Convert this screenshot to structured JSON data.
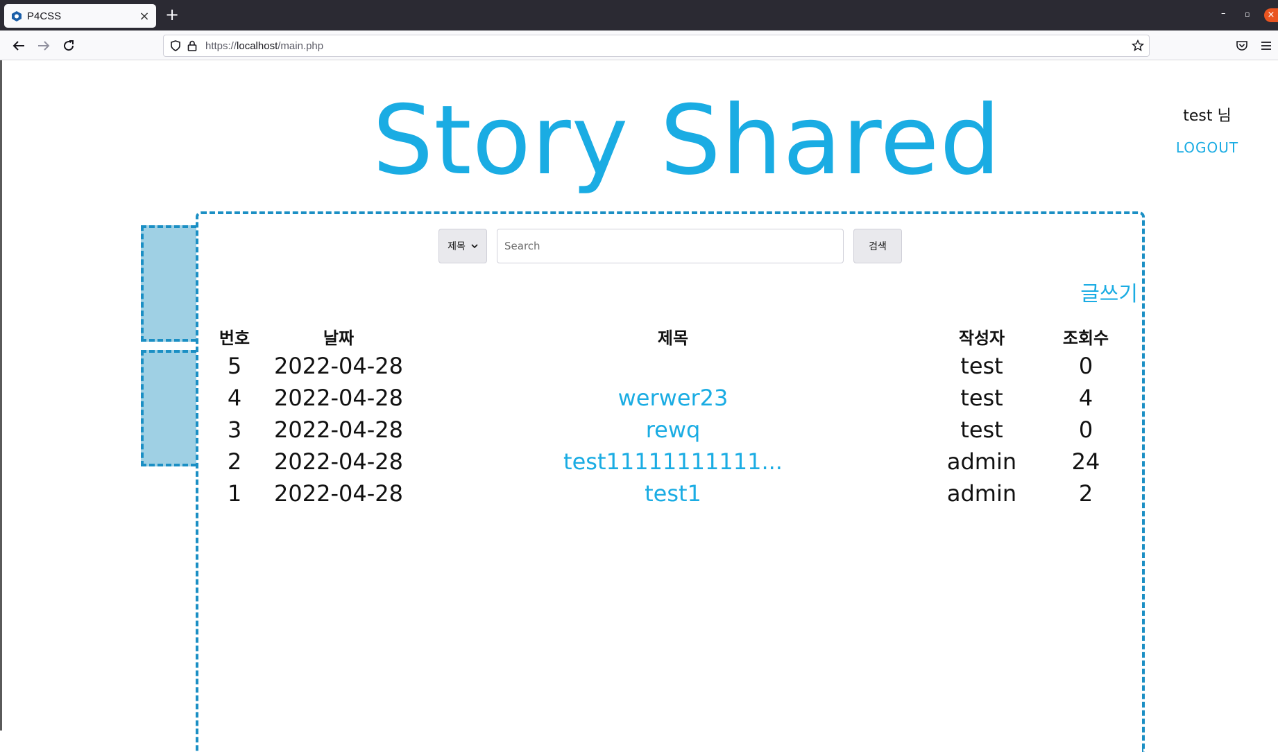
{
  "browser": {
    "tab_title": "P4CSS",
    "tab_close": "×",
    "new_tab": "+",
    "url_prefix": "https://",
    "url_host": "localhost",
    "url_path": "/main.php",
    "icons": [
      "favicon-icon",
      "back-arrow-icon",
      "forward-arrow-icon",
      "reload-icon",
      "shield-icon",
      "lock-icon",
      "star-icon",
      "pocket-icon",
      "menu-icon"
    ]
  },
  "header": {
    "title": "Story Shared",
    "user": "test 님",
    "logout": "LOGOUT"
  },
  "search": {
    "select_value": "제목",
    "placeholder": "Search",
    "button": "검색"
  },
  "write_link": "글쓰기",
  "table": {
    "columns": [
      "번호",
      "날짜",
      "제목",
      "작성자",
      "조회수"
    ],
    "rows": [
      {
        "no": "5",
        "date": "2022-04-28",
        "title": "",
        "writer": "test",
        "views": "0"
      },
      {
        "no": "4",
        "date": "2022-04-28",
        "title": "werwer23",
        "writer": "test",
        "views": "4"
      },
      {
        "no": "3",
        "date": "2022-04-28",
        "title": "rewq",
        "writer": "test",
        "views": "0"
      },
      {
        "no": "2",
        "date": "2022-04-28",
        "title": "test11111111111...",
        "writer": "admin",
        "views": "24"
      },
      {
        "no": "1",
        "date": "2022-04-28",
        "title": "test1",
        "writer": "admin",
        "views": "2"
      }
    ]
  },
  "colors": {
    "accent": "#1aace3",
    "dashed_border": "#1b8fc4",
    "side_box": "#9fd0e4"
  }
}
